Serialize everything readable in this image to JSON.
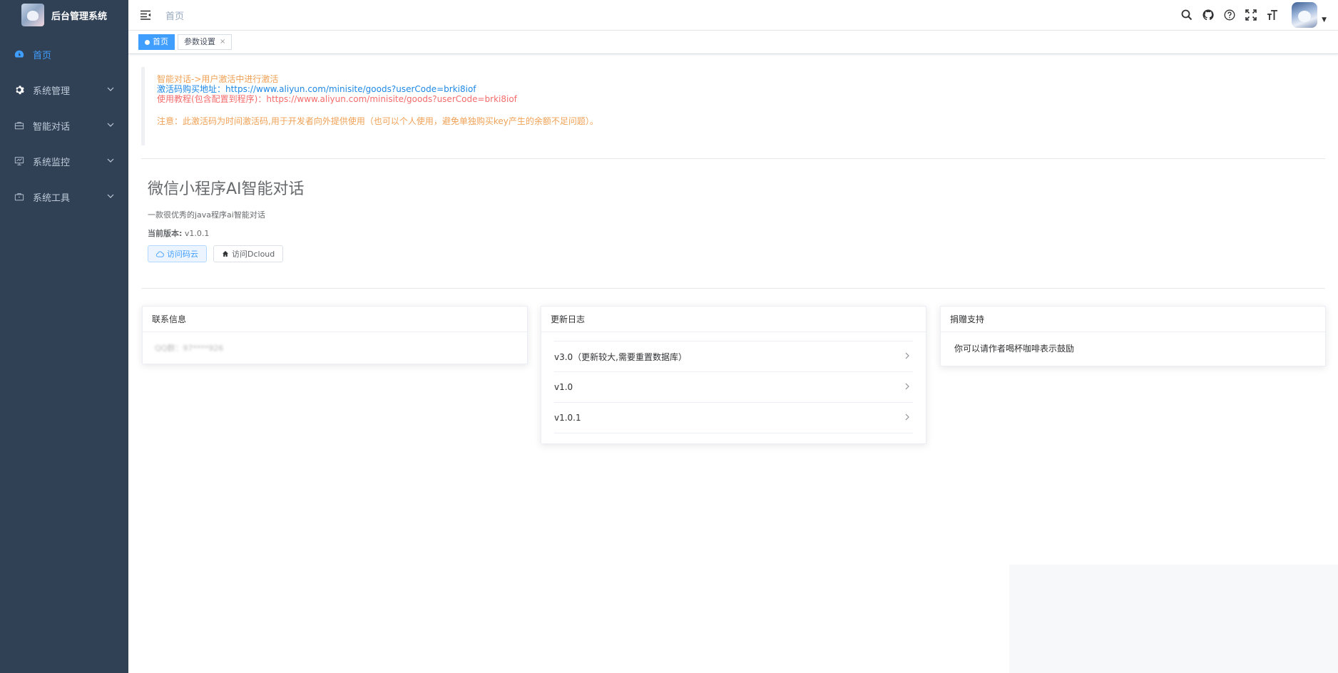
{
  "sidebar": {
    "title": "后台管理系统",
    "items": [
      {
        "label": "首页",
        "icon": "dashboard-icon",
        "active": true
      },
      {
        "label": "系统管理",
        "icon": "gear-icon"
      },
      {
        "label": "智能对话",
        "icon": "briefcase-icon"
      },
      {
        "label": "系统监控",
        "icon": "monitor-icon"
      },
      {
        "label": "系统工具",
        "icon": "toolbox-icon"
      }
    ]
  },
  "navbar": {
    "breadcrumb": "首页",
    "icons": [
      "search-icon",
      "github-icon",
      "question-icon",
      "fullscreen-icon",
      "font-size-icon"
    ]
  },
  "tags": [
    {
      "label": "首页",
      "active": true
    },
    {
      "label": "参数设置",
      "close": "×"
    }
  ],
  "notice": {
    "line1": "智能对话->用户激活中进行激活",
    "line2": "激活码购买地址：https://www.aliyun.com/minisite/goods?userCode=brki8iof",
    "line3": "使用教程(包含配置到程序)：https://www.aliyun.com/minisite/goods?userCode=brki8iof",
    "line4": "注意：此激活码为时间激活码,用于开发者向外提供使用（也可以个人使用，避免单独购买key产生的余额不足问题）。"
  },
  "intro": {
    "title": "微信小程序AI智能对话",
    "description": "一款很优秀的java程序ai智能对话",
    "version_label": "当前版本:",
    "version_value": "v1.0.1",
    "btn_gitee": "访问码云",
    "btn_dcloud": "访问Dcloud"
  },
  "cards": {
    "contact": {
      "title": "联系信息",
      "text": "QQ群：97****926"
    },
    "changelog": {
      "title": "更新日志",
      "items": [
        "v3.0（更新较大,需要重置数据库）",
        "v1.0",
        "v1.0.1"
      ]
    },
    "donate": {
      "title": "捐赠支持",
      "text": "你可以请作者喝杯咖啡表示鼓励"
    }
  },
  "colors": {
    "sidebar_bg": "#304156",
    "accent": "#409eff",
    "warning": "#f0a156",
    "danger": "#f56c6c"
  }
}
